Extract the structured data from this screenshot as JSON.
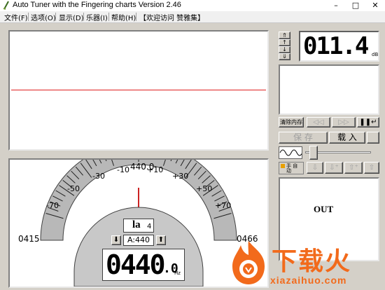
{
  "window": {
    "title": "Auto Tuner with the Fingering charts  Version 2.46",
    "minimize": "–",
    "maximize": "□",
    "close": "✕"
  },
  "menu": [
    {
      "label": "文件(F)"
    },
    {
      "label": "选项(O)"
    },
    {
      "label": "显示(D)"
    },
    {
      "label": "乐器(I)"
    },
    {
      "label": "帮助(H)"
    },
    {
      "label": "【欢迎访问 赞雅集】"
    }
  ],
  "colors": {
    "waveform_line": "#e02020",
    "needle": "#cc2222",
    "window_bg": "#d4d0c8"
  },
  "tuner": {
    "center_freq": "440.0",
    "left_freq": "0415",
    "right_freq": "0466",
    "scale_labels": [
      "-70",
      "-50",
      "-30",
      "-10",
      "+10",
      "+30",
      "+50",
      "+70"
    ],
    "note_name": "la",
    "octave": "4",
    "reference": "A:440",
    "frequency_big": "0440",
    "frequency_decimal": ".0",
    "frequency_unit": "Hz"
  },
  "level": {
    "value": "011.4",
    "unit": "dB"
  },
  "controls": {
    "clear_memory": "清除内存",
    "save": "保 存",
    "load": "载 入",
    "prev": "◁◁",
    "next": "▷▷",
    "pause": "❚❚↵",
    "manual_auto": "手 自 动"
  },
  "output": {
    "label": "OUT"
  },
  "watermark": {
    "brand": "下载火",
    "url": "xiazaihuo.com"
  }
}
